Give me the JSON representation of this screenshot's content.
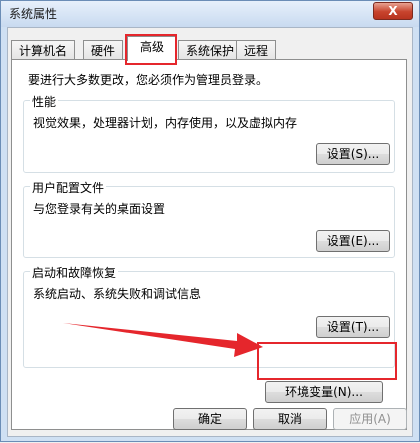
{
  "window": {
    "title": "系统属性",
    "close_glyph": "X"
  },
  "tabs": [
    {
      "label": "计算机名"
    },
    {
      "label": "硬件"
    },
    {
      "label": "高级"
    },
    {
      "label": "系统保护"
    },
    {
      "label": "远程"
    }
  ],
  "notice": "要进行大多数更改，您必须作为管理员登录。",
  "performance": {
    "title": "性能",
    "description": "视觉效果，处理器计划，内存使用，以及虚拟内存",
    "button": "设置(S)..."
  },
  "user_profiles": {
    "title": "用户配置文件",
    "description": "与您登录有关的桌面设置",
    "button": "设置(E)..."
  },
  "startup_recovery": {
    "title": "启动和故障恢复",
    "description": "系统启动、系统失败和调试信息",
    "button": "设置(T)..."
  },
  "env_button": "环境变量(N)...",
  "footer": {
    "ok": "确定",
    "cancel": "取消",
    "apply": "应用(A)"
  },
  "annotation_color": "#e5262c"
}
